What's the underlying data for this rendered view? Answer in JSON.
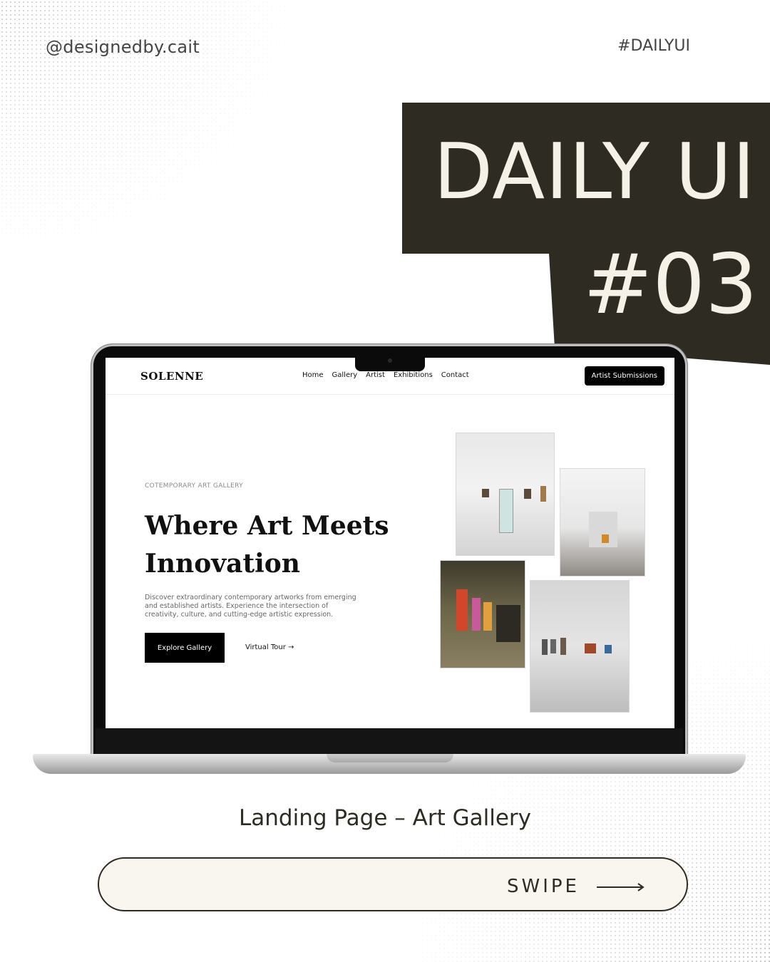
{
  "header": {
    "handle": "@designedby.cait",
    "hashtag": "#DAILYUI"
  },
  "title": {
    "line1": "DAILY UI",
    "line2": "#03"
  },
  "colors": {
    "dark_block": "#2e2c22",
    "title_text": "#f6f1e7",
    "swipe_bg": "#f8f6ef"
  },
  "site": {
    "logo": "SOLENNE",
    "nav": [
      "Home",
      "Gallery",
      "Artist",
      "Exhibitions",
      "Contact"
    ],
    "cta": "Artist Submissions",
    "eyebrow": "COTEMPORARY ART GALLERY",
    "headline": "Where Art Meets Innovation",
    "description": "Discover extraordinary contemporary artworks from emerging and established artists. Experience the intersection of creativity, culture, and cutting-edge artistic expression.",
    "primary_button": "Explore Gallery",
    "secondary_link": "Virtual Tour →"
  },
  "caption": "Landing Page – Art Gallery",
  "swipe": {
    "label": "SWIPE",
    "icon": "arrow-right-icon"
  }
}
